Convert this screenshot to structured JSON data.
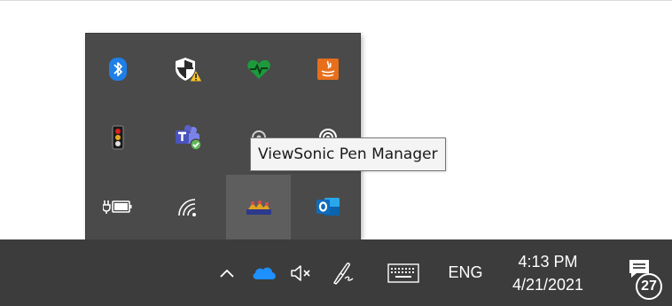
{
  "tooltip": {
    "text": "ViewSonic Pen Manager"
  },
  "tray_flyout": {
    "icons": [
      {
        "name": "bluetooth-icon",
        "color": "#1e7fe6"
      },
      {
        "name": "windows-security-warning-icon",
        "color": "#f7c325"
      },
      {
        "name": "health-monitor-icon",
        "color": "#1d9a3c"
      },
      {
        "name": "java-update-icon",
        "color": "#e76f1c"
      },
      {
        "name": "usb-traffic-light-icon",
        "color": "#d82c2c"
      },
      {
        "name": "microsoft-teams-icon",
        "color": "#5b5fc7"
      },
      {
        "name": "viewsonic-app-icon",
        "color": "#cccccc"
      },
      {
        "name": "sync-app-icon",
        "color": "#ffffff"
      },
      {
        "name": "battery-charging-icon",
        "color": "#ffffff"
      },
      {
        "name": "wifi-icon",
        "color": "#ffffff"
      },
      {
        "name": "viewsonic-pen-manager-icon",
        "color": "#e5a21b"
      },
      {
        "name": "outlook-icon",
        "color": "#0f6cbd"
      }
    ]
  },
  "taskbar": {
    "language": "ENG",
    "time": "4:13 PM",
    "date": "4/21/2021",
    "notification_count": "27",
    "icons": {
      "chevron": "chevron-up-icon",
      "onedrive": "onedrive-icon",
      "volume": "volume-muted-icon",
      "pen": "pen-workspace-icon",
      "keyboard": "touch-keyboard-icon",
      "notifications": "action-center-icon"
    },
    "onedrive_color": "#1e90ff"
  }
}
